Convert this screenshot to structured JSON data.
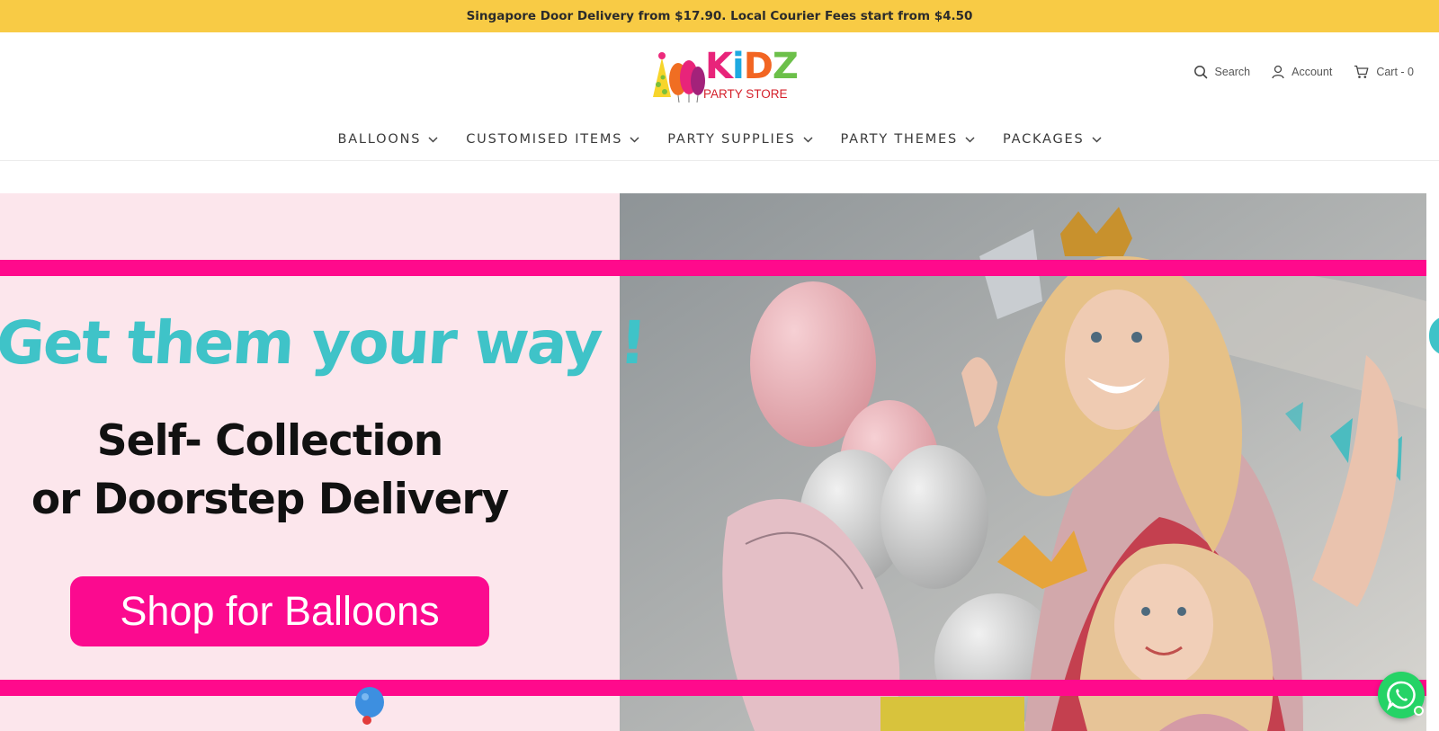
{
  "announcement": {
    "text": "Singapore Door Delivery from $17.90. Local Courier Fees start from $4.50",
    "bg": "#f8cb45"
  },
  "logo": {
    "word": "KiDZ",
    "letter_colors": [
      "#e8247a",
      "#1ea9e1",
      "#f26522",
      "#6cc04a"
    ],
    "subtitle": "PARTY STORE",
    "subtitle_color": "#d41f2a"
  },
  "header": {
    "search_label": "Search",
    "account_label": "Account",
    "cart_label": "Cart - 0"
  },
  "nav": {
    "items": [
      {
        "label": "BALLOONS",
        "icon": "chevron-down-icon"
      },
      {
        "label": "CUSTOMISED ITEMS",
        "icon": "chevron-down-icon"
      },
      {
        "label": "PARTY SUPPLIES",
        "icon": "chevron-down-icon"
      },
      {
        "label": "PARTY THEMES",
        "icon": "chevron-down-icon"
      },
      {
        "label": "PACKAGES",
        "icon": "chevron-down-icon"
      }
    ]
  },
  "hero": {
    "headline": "Get them your way !",
    "line1": "Self- Collection",
    "line2": "or Doorstep Delivery",
    "button_label": "Shop for Balloons",
    "edge_glyph": "G",
    "image_alt": "hero-photo-woman-and-girl-with-balloons",
    "colors": {
      "panel_bg": "#fce6ec",
      "stripe": "#ff0a8c",
      "headline": "#3fc3c8",
      "button": "#fb0a8f"
    }
  },
  "whatsapp": {
    "icon": "whatsapp-icon",
    "color": "#25d366"
  }
}
